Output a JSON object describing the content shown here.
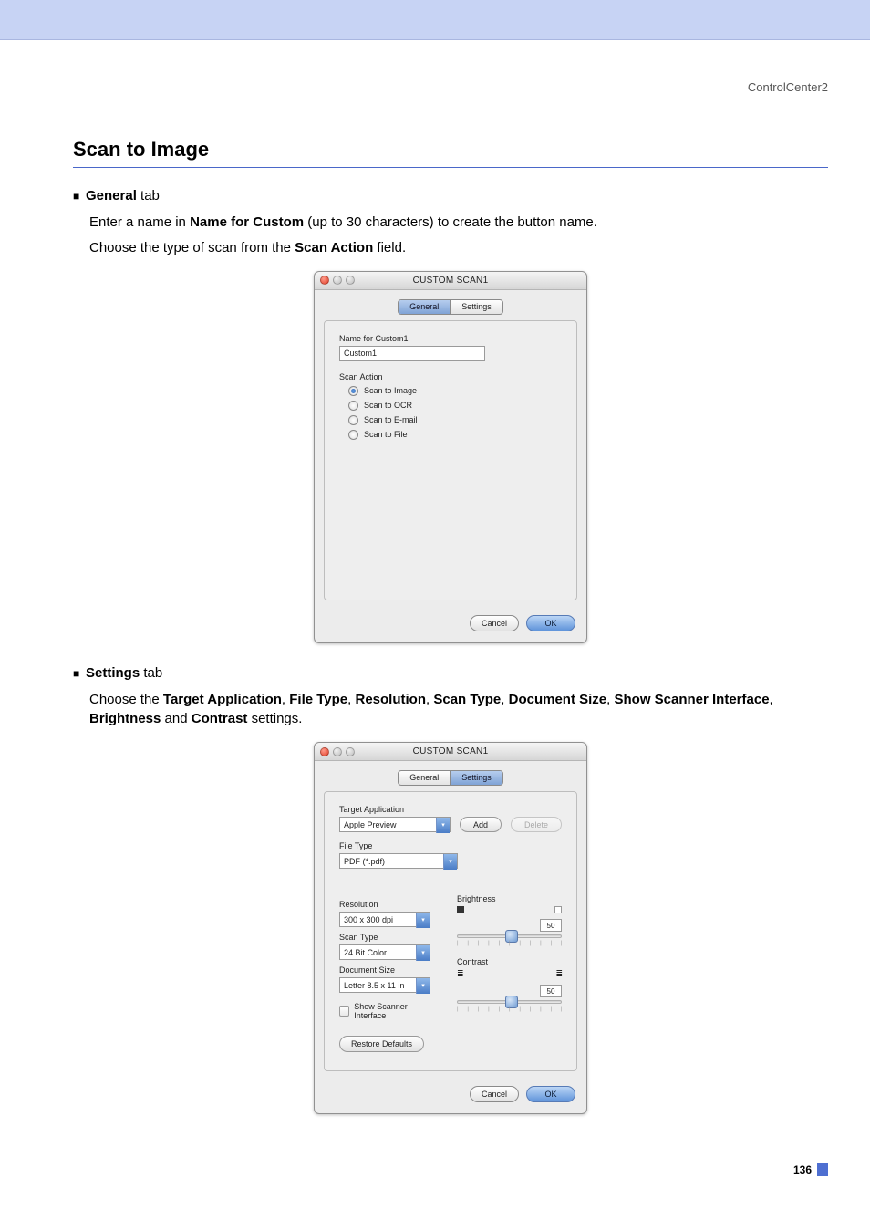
{
  "header": {
    "right": "ControlCenter2"
  },
  "title": "Scan to Image",
  "general": {
    "bullet_label": "General",
    "bullet_suffix": " tab",
    "para1_pre": "Enter a name in ",
    "para1_bold": "Name for Custom",
    "para1_post": " (up to 30 characters) to create the button name.",
    "para2_pre": "Choose the type of scan from the ",
    "para2_bold": "Scan Action",
    "para2_post": " field."
  },
  "settings": {
    "bullet_label": "Settings",
    "bullet_suffix": " tab",
    "para_pre": "Choose the ",
    "b1": "Target Application",
    "c1": ", ",
    "b2": "File Type",
    "c2": ", ",
    "b3": "Resolution",
    "c3": ", ",
    "b4": "Scan Type",
    "c4": ", ",
    "b5": "Document Size",
    "c5": ", ",
    "b6": "Show Scanner Interface",
    "c6": ", ",
    "b7": "Brightness",
    "c7": " and ",
    "b8": "Contrast",
    "c8": " settings."
  },
  "dlg1": {
    "title": "CUSTOM SCAN1",
    "tab_general": "General",
    "tab_settings": "Settings",
    "name_label": "Name for Custom1",
    "name_value": "Custom1",
    "scan_action_label": "Scan Action",
    "radios": [
      "Scan to Image",
      "Scan to OCR",
      "Scan to E-mail",
      "Scan to File"
    ],
    "cancel": "Cancel",
    "ok": "OK"
  },
  "dlg2": {
    "title": "CUSTOM SCAN1",
    "tab_general": "General",
    "tab_settings": "Settings",
    "target_app_label": "Target Application",
    "target_app_value": "Apple Preview",
    "add": "Add",
    "delete": "Delete",
    "file_type_label": "File Type",
    "file_type_value": "PDF (*.pdf)",
    "resolution_label": "Resolution",
    "resolution_value": "300 x 300 dpi",
    "scan_type_label": "Scan Type",
    "scan_type_value": "24 Bit Color",
    "doc_size_label": "Document Size",
    "doc_size_value": "Letter  8.5 x 11 in",
    "show_scanner": "Show Scanner Interface",
    "brightness_label": "Brightness",
    "brightness_value": "50",
    "contrast_label": "Contrast",
    "contrast_value": "50",
    "restore": "Restore Defaults",
    "cancel": "Cancel",
    "ok": "OK"
  },
  "page_number": "136"
}
